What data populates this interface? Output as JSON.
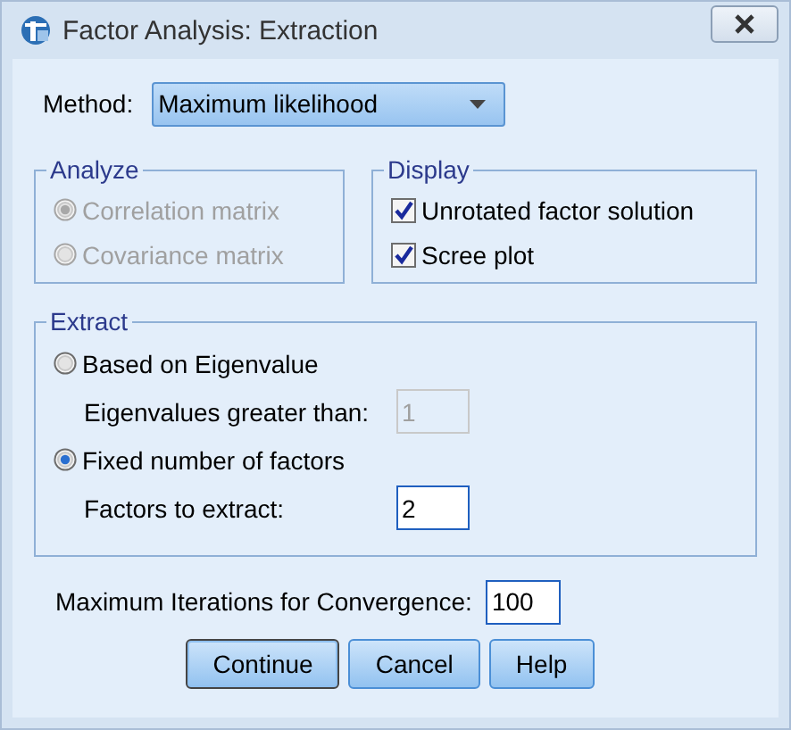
{
  "window": {
    "title": "Factor Analysis: Extraction"
  },
  "method": {
    "label": "Method:",
    "value": "Maximum likelihood"
  },
  "analyze": {
    "title": "Analyze",
    "options": [
      {
        "label": "Correlation matrix",
        "selected": true,
        "disabled": true
      },
      {
        "label": "Covariance matrix",
        "selected": false,
        "disabled": true
      }
    ]
  },
  "display": {
    "title": "Display",
    "options": [
      {
        "label": "Unrotated factor solution",
        "checked": true
      },
      {
        "label": "Scree plot",
        "checked": true
      }
    ]
  },
  "extract": {
    "title": "Extract",
    "options": [
      {
        "label": "Based on Eigenvalue",
        "selected": false,
        "field": {
          "label": "Eigenvalues greater than:",
          "value": "1",
          "disabled": true
        }
      },
      {
        "label": "Fixed number of factors",
        "selected": true,
        "field": {
          "label": "Factors to extract:",
          "value": "2",
          "disabled": false
        }
      }
    ]
  },
  "iterations": {
    "label": "Maximum Iterations for Convergence:",
    "value": "100"
  },
  "buttons": [
    {
      "label": "Continue",
      "focused": true
    },
    {
      "label": "Cancel",
      "focused": false
    },
    {
      "label": "Help",
      "focused": false
    }
  ]
}
